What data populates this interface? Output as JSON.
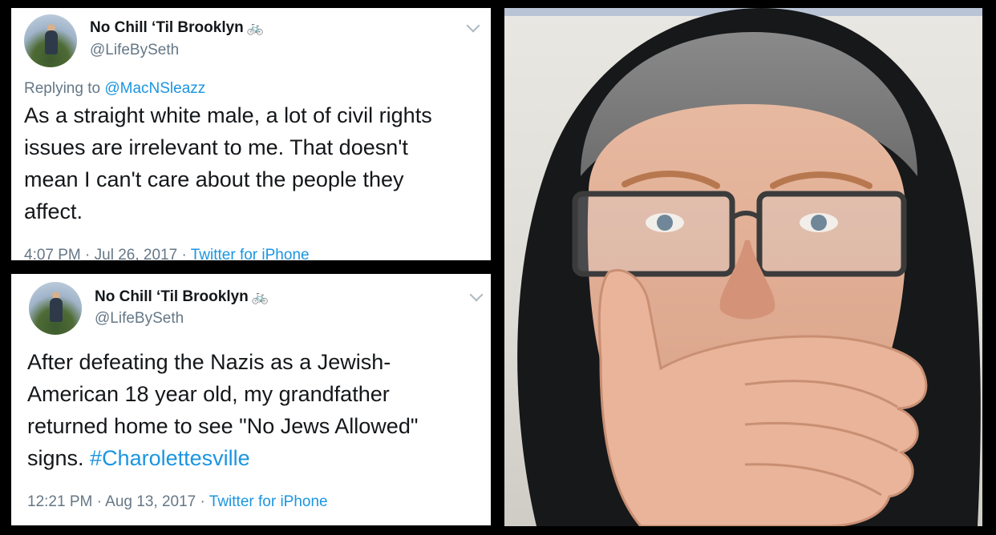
{
  "tweets": [
    {
      "display_name": "No Chill ‘Til Brooklyn",
      "emoji": "🚲",
      "handle": "@LifeBySeth",
      "replying_prefix": "Replying to ",
      "replying_to": "@MacNSleazz",
      "lines": [
        "As a straight white male, a lot of civil rights",
        "issues are irrelevant to me. That doesn't",
        "mean I can't care about the people they",
        "affect."
      ],
      "time": "4:07 PM",
      "date": "Jul 26, 2017",
      "source": "Twitter for iPhone"
    },
    {
      "display_name": "No Chill ‘Til Brooklyn",
      "emoji": "🚲",
      "handle": "@LifeBySeth",
      "lines": [
        "After defeating the Nazis as a Jewish-",
        "American 18 year old, my grandfather",
        "returned home to see \"No Jews Allowed\""
      ],
      "last_line_text": "signs. ",
      "hashtag": "#Charolettesville",
      "time": "12:21 PM",
      "date": "Aug 13, 2017",
      "source": "Twitter for iPhone"
    }
  ],
  "separator": " · ",
  "icons": {
    "more": "chevron-down-icon",
    "avatar": "avatar-photo"
  },
  "colors": {
    "link": "#1b95e0",
    "muted": "#657786",
    "text": "#14171a"
  }
}
